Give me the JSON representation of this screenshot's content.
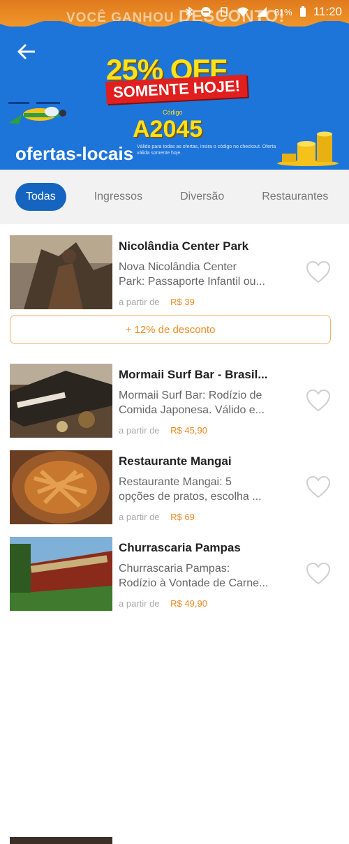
{
  "status_bar": {
    "promo_text": "VOCÊ GANHOU",
    "promo_bold": "DESCONTO!",
    "time": "11:20",
    "battery": "81%"
  },
  "banner": {
    "headline": "25% OFF",
    "subline": "SOMENTE HOJE!",
    "code_label": "Código",
    "code": "A2045",
    "brand": "ofertas-locais",
    "fine_print": "Válido para todas as ofertas, insira o código no checkout. Oferta válida somente hoje."
  },
  "tabs": [
    {
      "label": "Todas",
      "active": true
    },
    {
      "label": "Ingressos",
      "active": false
    },
    {
      "label": "Diversão",
      "active": false
    },
    {
      "label": "Restaurantes",
      "active": false
    }
  ],
  "items": [
    {
      "title": "Nicolândia Center Park",
      "desc_line1": "Nova Nicolândia Center",
      "desc_line2": "Park: Passaporte Infantil ou...",
      "price_prefix": "a partir de",
      "price": "R$ 39",
      "discount": "+ 12% de desconto"
    },
    {
      "title": "Mormaii Surf Bar - Brasil...",
      "desc_line1": "Mormaii Surf Bar: Rodízio de",
      "desc_line2": "Comida Japonesa. Válido e...",
      "price_prefix": "a partir de",
      "price": "R$ 45,90"
    },
    {
      "title": "Restaurante Mangai",
      "desc_line1": "Restaurante Mangai: 5",
      "desc_line2": "opções de pratos, escolha ...",
      "price_prefix": "a partir de",
      "price": "R$ 69"
    },
    {
      "title": "Churrascaria Pampas",
      "desc_line1": "Churrascaria Pampas:",
      "desc_line2": "Rodízio à Vontade de Carne...",
      "price_prefix": "a partir de",
      "price": "R$ 49,90"
    }
  ],
  "colors": {
    "banner_blue": "#1d74d9",
    "accent_orange": "#f08a24",
    "tab_active": "#1565c0"
  }
}
